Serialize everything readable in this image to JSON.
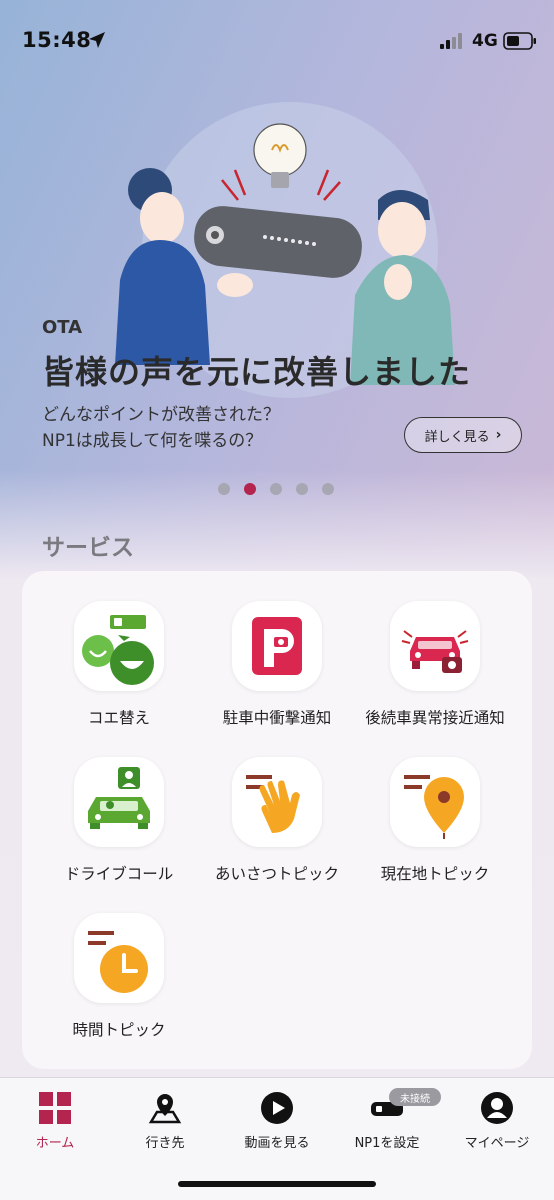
{
  "status_bar": {
    "time": "15:48",
    "network": "4G"
  },
  "hero": {
    "tag": "OTA",
    "title": "皆様の声を元に改善しました",
    "subtitle": "どんなポイントが改善された？\nNP1は成長して何を喋るの？",
    "detail_button": "詳しく見る",
    "pages": 5,
    "active_page": 2
  },
  "services": {
    "title": "サービス",
    "items": [
      {
        "label": "コエ替え",
        "icon": "voice-change-icon"
      },
      {
        "label": "駐車中衝撃通知",
        "icon": "parking-shock-icon"
      },
      {
        "label": "後続車異常接近通知",
        "icon": "tailgating-alert-icon"
      },
      {
        "label": "ドライブコール",
        "icon": "drive-call-icon"
      },
      {
        "label": "あいさつトピック",
        "icon": "greeting-hand-icon"
      },
      {
        "label": "現在地トピック",
        "icon": "location-pin-icon"
      },
      {
        "label": "時間トピック",
        "icon": "clock-icon"
      }
    ]
  },
  "tab_bar": {
    "items": [
      {
        "label": "ホーム",
        "icon": "home-grid-icon",
        "active": true
      },
      {
        "label": "行き先",
        "icon": "map-pin-icon",
        "active": false
      },
      {
        "label": "動画を見る",
        "icon": "play-icon",
        "active": false
      },
      {
        "label": "NP1を設定",
        "icon": "device-icon",
        "active": false
      },
      {
        "label": "マイページ",
        "icon": "person-icon",
        "active": false
      }
    ],
    "badge": "未接続"
  },
  "colors": {
    "accent": "#b3254e",
    "green": "#5aa832",
    "orange": "#f5a623",
    "brown": "#8b3a2a"
  }
}
